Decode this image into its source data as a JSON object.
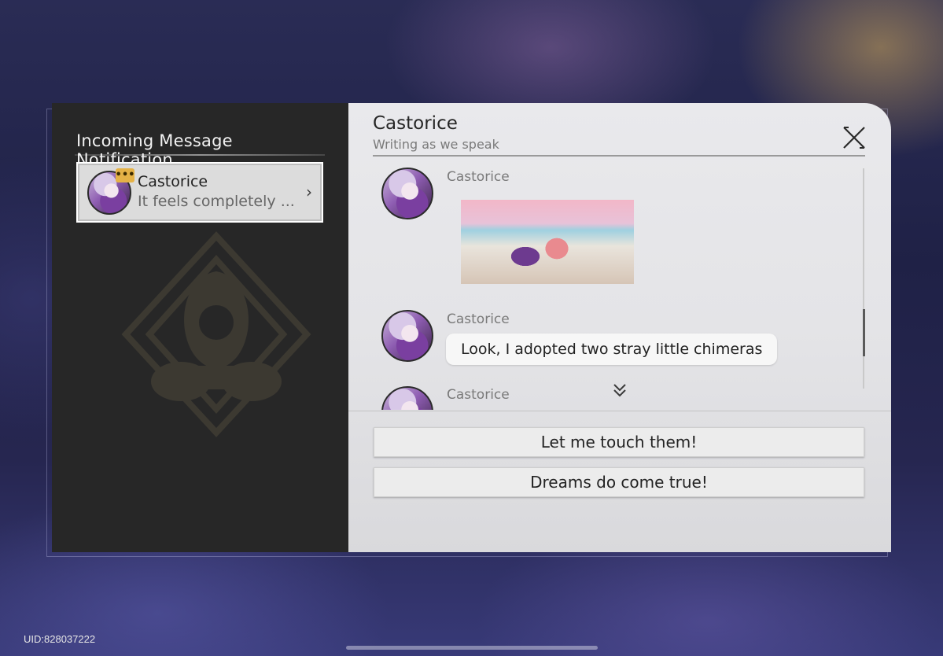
{
  "left_panel": {
    "title": "Incoming Message Notification",
    "contact": {
      "name": "Castorice",
      "preview": "It feels completely ...",
      "typing_badge": "•••",
      "chevron": "›"
    }
  },
  "chat": {
    "title": "Castorice",
    "subtitle": "Writing as we speak",
    "messages": [
      {
        "sender": "Castorice",
        "type": "image"
      },
      {
        "sender": "Castorice",
        "type": "text",
        "text": "Look, I adopted two stray little chimeras"
      },
      {
        "sender": "Castorice",
        "type": "partial"
      }
    ]
  },
  "options": [
    {
      "label": "Let me touch them!"
    },
    {
      "label": "Dreams do come true!"
    }
  ],
  "uid": "UID:828037222",
  "colors": {
    "left_panel_bg": "#272727",
    "right_panel_bg": "#e6e6e9",
    "typing_badge": "#e5b246"
  }
}
